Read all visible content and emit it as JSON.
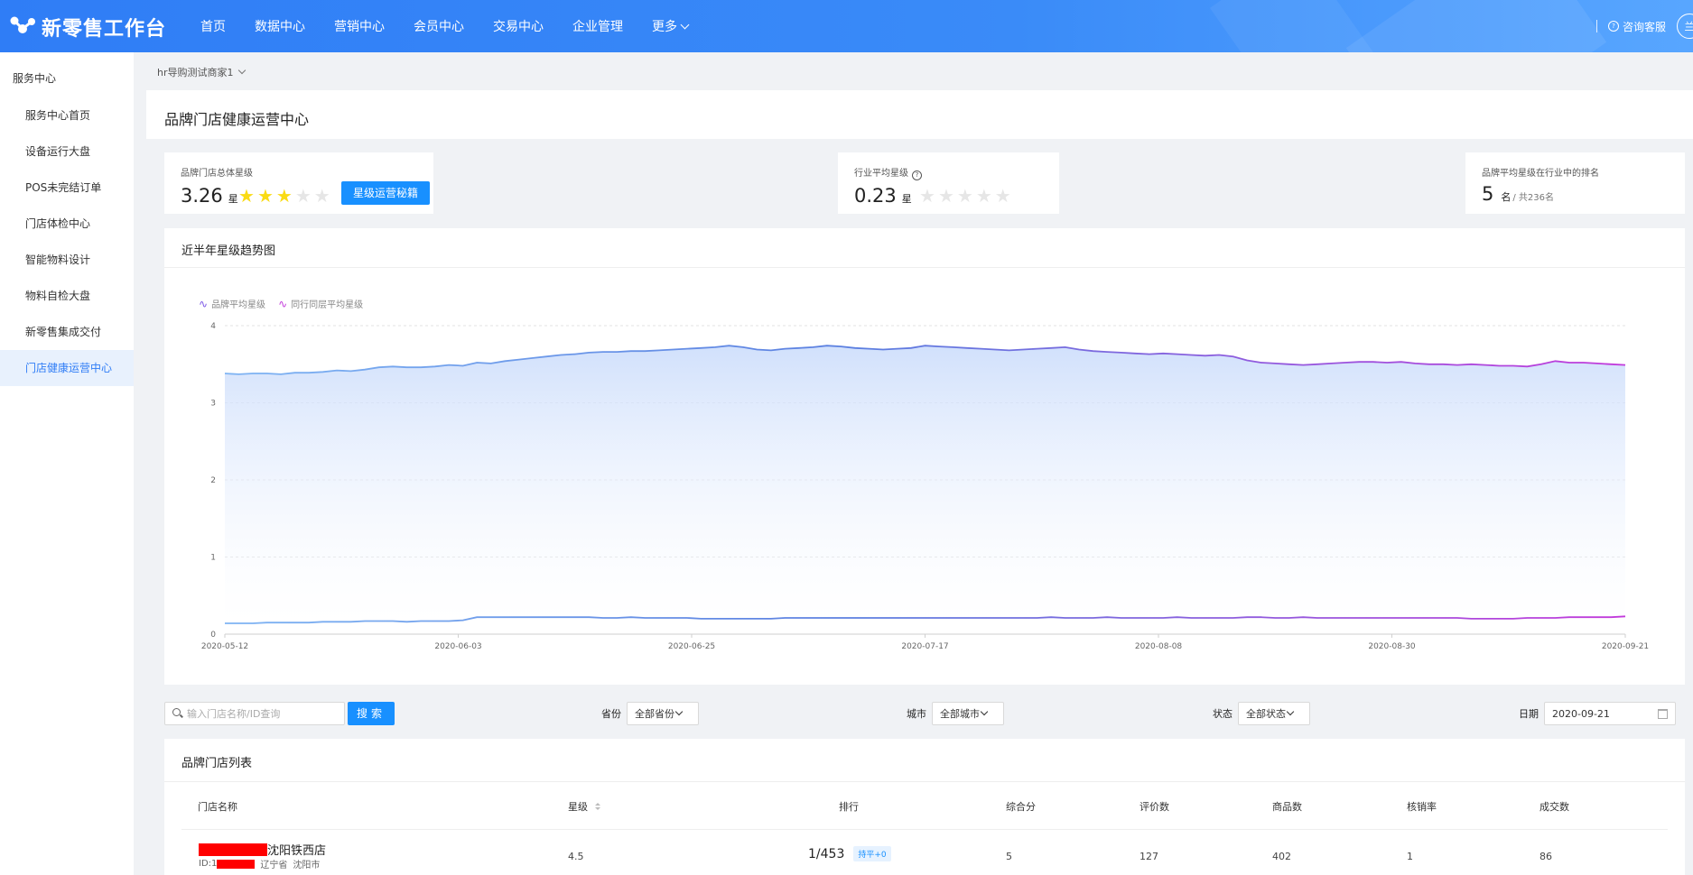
{
  "app": {
    "logo_text": "新零售工作台"
  },
  "nav": {
    "items": [
      "首页",
      "数据中心",
      "营销中心",
      "会员中心",
      "交易中心",
      "企业管理"
    ],
    "more": "更多"
  },
  "header_right": {
    "service": "咨询客服",
    "avatar": "兰"
  },
  "sidebar": {
    "title": "服务中心",
    "items": [
      {
        "label": "服务中心首页"
      },
      {
        "label": "设备运行大盘"
      },
      {
        "label": "POS未完结订单"
      },
      {
        "label": "门店体检中心"
      },
      {
        "label": "智能物料设计"
      },
      {
        "label": "物料自检大盘"
      },
      {
        "label": "新零售集成交付"
      },
      {
        "label": "门店健康运营中心",
        "active": true
      }
    ]
  },
  "breadcrumb": "hr导购测试商家1",
  "page_title": "品牌门店健康运营中心",
  "cards": {
    "brand": {
      "label": "品牌门店总体星级",
      "value": "3.26",
      "unit": "星",
      "stars_filled": 3,
      "stars_total": 5,
      "button": "星级运营秘籍"
    },
    "industry": {
      "label": "行业平均星级",
      "help": "?",
      "value": "0.23",
      "unit": "星",
      "stars_filled": 0,
      "stars_total": 5
    },
    "ranking": {
      "label": "品牌平均星级在行业中的排名",
      "value": "5",
      "unit": "名",
      "total": "/ 共236名"
    }
  },
  "chart_section": {
    "title": "近半年星级趋势图"
  },
  "chart_data": {
    "type": "area",
    "legend": [
      "品牌平均星级",
      "同行同层平均星级"
    ],
    "ylim": [
      0,
      4
    ],
    "yticks": [
      "0",
      "1",
      "2",
      "3",
      "4"
    ],
    "xticks": [
      "2020-05-12",
      "2020-06-03",
      "2020-06-25",
      "2020-07-17",
      "2020-08-08",
      "2020-08-30",
      "2020-09-21"
    ],
    "colors": {
      "start": "#7fb4f3",
      "mid": "#5b7fe0",
      "end": "#c23adb"
    },
    "series": [
      {
        "name": "品牌平均星级",
        "values": [
          3.38,
          3.37,
          3.38,
          3.38,
          3.37,
          3.39,
          3.39,
          3.4,
          3.42,
          3.41,
          3.43,
          3.46,
          3.47,
          3.46,
          3.46,
          3.47,
          3.49,
          3.48,
          3.52,
          3.51,
          3.54,
          3.56,
          3.58,
          3.6,
          3.62,
          3.63,
          3.65,
          3.66,
          3.66,
          3.67,
          3.67,
          3.68,
          3.69,
          3.7,
          3.71,
          3.72,
          3.74,
          3.72,
          3.69,
          3.68,
          3.7,
          3.71,
          3.72,
          3.74,
          3.73,
          3.71,
          3.7,
          3.69,
          3.7,
          3.71,
          3.74,
          3.73,
          3.72,
          3.71,
          3.7,
          3.69,
          3.68,
          3.69,
          3.7,
          3.71,
          3.72,
          3.69,
          3.67,
          3.66,
          3.65,
          3.64,
          3.63,
          3.64,
          3.63,
          3.62,
          3.61,
          3.62,
          3.6,
          3.55,
          3.52,
          3.51,
          3.5,
          3.49,
          3.5,
          3.51,
          3.52,
          3.53,
          3.53,
          3.52,
          3.53,
          3.51,
          3.5,
          3.5,
          3.49,
          3.5,
          3.49,
          3.48,
          3.48,
          3.47,
          3.5,
          3.54,
          3.52,
          3.52,
          3.51,
          3.5,
          3.49
        ]
      },
      {
        "name": "同行同层平均星级",
        "values": [
          0.14,
          0.14,
          0.14,
          0.15,
          0.15,
          0.15,
          0.15,
          0.16,
          0.16,
          0.16,
          0.17,
          0.17,
          0.17,
          0.16,
          0.17,
          0.17,
          0.17,
          0.18,
          0.22,
          0.22,
          0.22,
          0.22,
          0.22,
          0.22,
          0.22,
          0.22,
          0.22,
          0.21,
          0.21,
          0.22,
          0.21,
          0.21,
          0.21,
          0.21,
          0.2,
          0.2,
          0.2,
          0.2,
          0.2,
          0.2,
          0.21,
          0.21,
          0.21,
          0.21,
          0.21,
          0.21,
          0.21,
          0.21,
          0.21,
          0.21,
          0.21,
          0.21,
          0.21,
          0.21,
          0.21,
          0.21,
          0.21,
          0.21,
          0.21,
          0.22,
          0.21,
          0.21,
          0.21,
          0.22,
          0.21,
          0.21,
          0.21,
          0.21,
          0.22,
          0.21,
          0.21,
          0.21,
          0.21,
          0.22,
          0.22,
          0.21,
          0.21,
          0.22,
          0.21,
          0.21,
          0.21,
          0.21,
          0.21,
          0.21,
          0.21,
          0.21,
          0.21,
          0.21,
          0.21,
          0.2,
          0.2,
          0.2,
          0.2,
          0.21,
          0.21,
          0.21,
          0.22,
          0.22,
          0.22,
          0.22,
          0.23
        ]
      }
    ]
  },
  "filters": {
    "search_placeholder": "输入门店名称/ID查询",
    "search_button": "搜索",
    "province": {
      "label": "省份",
      "value": "全部省份"
    },
    "city": {
      "label": "城市",
      "value": "全部城市"
    },
    "status": {
      "label": "状态",
      "value": "全部状态"
    },
    "date": {
      "label": "日期",
      "value": "2020-09-21"
    }
  },
  "list": {
    "title": "品牌门店列表",
    "columns": [
      "门店名称",
      "星级",
      "排行",
      "综合分",
      "评价数",
      "商品数",
      "核销率",
      "成交数"
    ],
    "rows": [
      {
        "name_suffix": "沈阳铁西店",
        "id_prefix": "ID:1",
        "province": "辽宁省",
        "city": "沈阳市",
        "stars": "4.5",
        "rank": "1/453",
        "rank_tag": "持平+0",
        "score": "5",
        "reviews": "127",
        "products": "402",
        "writeoff": "1",
        "deals": "86"
      }
    ]
  }
}
